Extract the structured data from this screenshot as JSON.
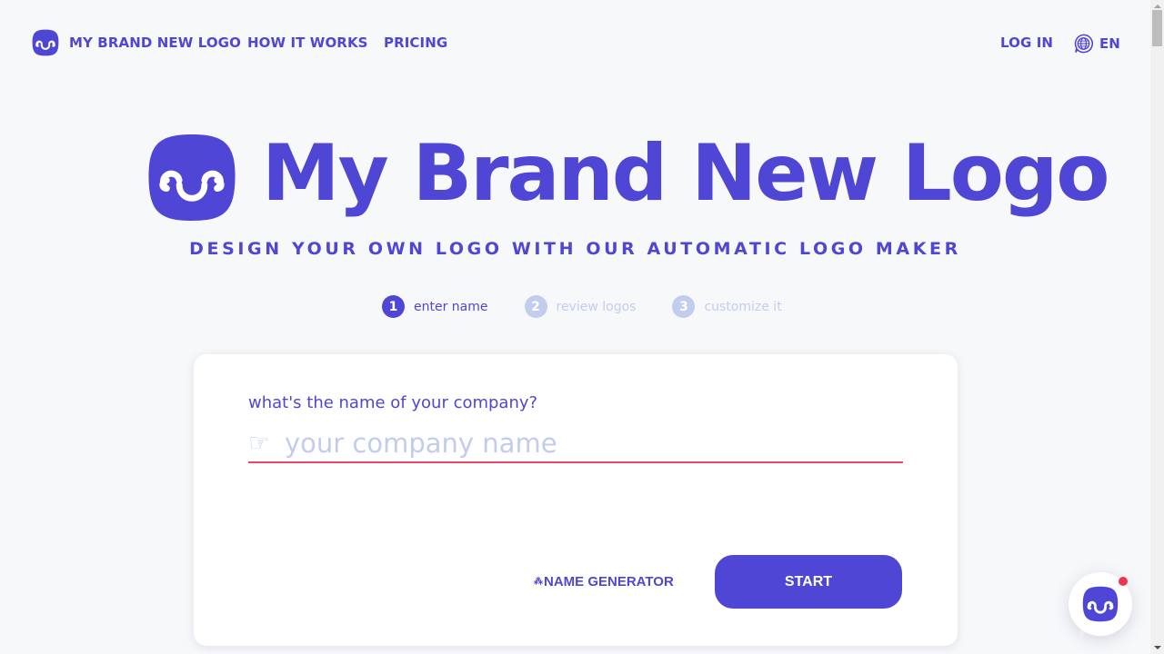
{
  "colors": {
    "brand": "#4f46d6",
    "inactive": "#c2cdee",
    "underline": "#ef4466",
    "notification": "#f0364f",
    "background": "#f7f8fa"
  },
  "nav": {
    "brand_label": "MY BRAND NEW LOGO",
    "how_it_works": "HOW IT WORKS",
    "pricing": "PRICING",
    "login": "LOG IN",
    "language": "EN",
    "language_icon": "globe-chat-icon"
  },
  "hero": {
    "title": "My Brand New Logo",
    "subtitle": "DESIGN YOUR OWN LOGO WITH OUR AUTOMATIC LOGO MAKER"
  },
  "steps": [
    {
      "number": "1",
      "label": "enter name",
      "state": "active"
    },
    {
      "number": "2",
      "label": "review logos",
      "state": "inactive"
    },
    {
      "number": "3",
      "label": "customize it",
      "state": "inactive"
    }
  ],
  "form": {
    "label": "what's the name of your company?",
    "input_icon": "☞",
    "input_value": "",
    "input_placeholder": "your company name",
    "name_generator_icon": "⁂",
    "name_generator_label": "NAME GENERATOR",
    "start_label": "START"
  },
  "chat": {
    "has_notification": true
  }
}
